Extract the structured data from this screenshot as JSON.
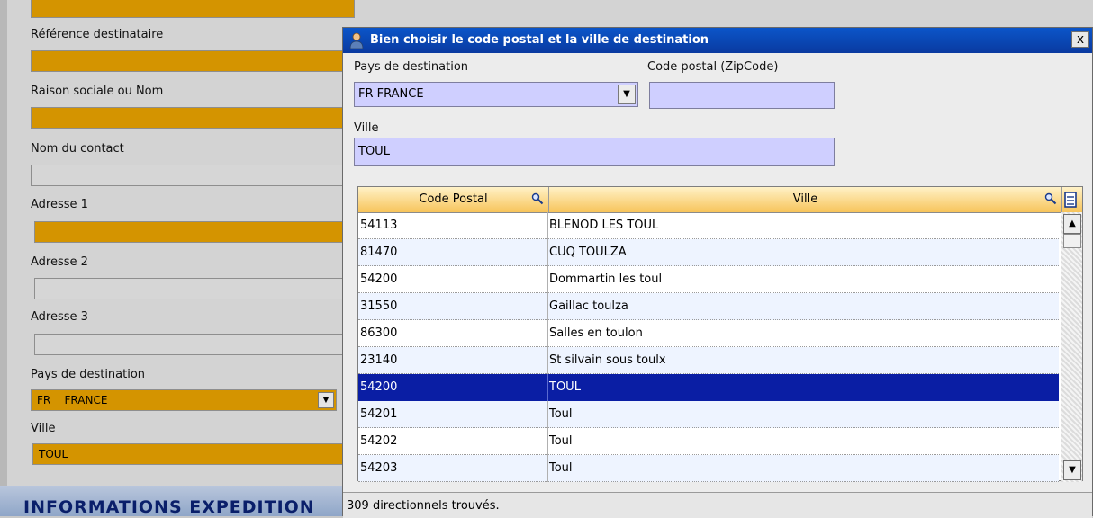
{
  "background_form": {
    "labels": {
      "ref_dest": "Référence destinataire",
      "raison": "Raison sociale ou Nom",
      "contact": "Nom du contact",
      "adresse1": "Adresse 1",
      "adresse2": "Adresse 2",
      "adresse3": "Adresse 3",
      "pays": "Pays de destination",
      "ville": "Ville"
    },
    "pays_value": "FR    FRANCE",
    "ville_value": "TOUL",
    "section_title": "INFORMATIONS EXPEDITION"
  },
  "dialog": {
    "title": "Bien choisir le code postal et la ville de destination",
    "close_label": "x",
    "pays_label": "Pays de destination",
    "pays_value": "FR FRANCE",
    "code_postal_label": "Code postal (ZipCode)",
    "code_postal_value": "",
    "ville_label": "Ville",
    "ville_value": "TOUL",
    "columns": [
      "Code Postal",
      "Ville"
    ],
    "rows": [
      {
        "code": "54113",
        "ville": "BLENOD LES TOUL"
      },
      {
        "code": "81470",
        "ville": "CUQ TOULZA"
      },
      {
        "code": "54200",
        "ville": "Dommartin les toul"
      },
      {
        "code": "31550",
        "ville": "Gaillac toulza"
      },
      {
        "code": "86300",
        "ville": "Salles en toulon"
      },
      {
        "code": "23140",
        "ville": "St silvain sous toulx"
      },
      {
        "code": "54200",
        "ville": "TOUL"
      },
      {
        "code": "54201",
        "ville": "Toul"
      },
      {
        "code": "54202",
        "ville": "Toul"
      },
      {
        "code": "54203",
        "ville": "Toul"
      }
    ],
    "selected_index": 6,
    "status": "309 directionnels trouvés."
  },
  "colors": {
    "field_orange": "#d49400",
    "dialog_input": "#cfcfff",
    "selection": "#0a1ea4",
    "titlebar": "#0a4ab5"
  }
}
